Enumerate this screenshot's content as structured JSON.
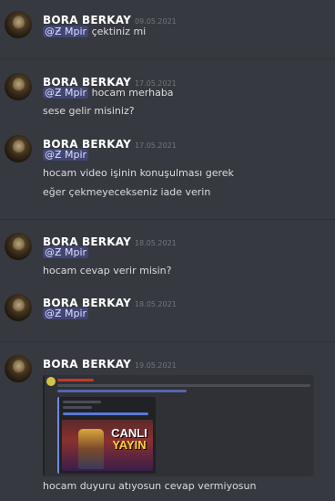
{
  "colors": {
    "background": "#36393f",
    "author": "#ffffff",
    "timestamp": "#72767d",
    "mention_bg": "#414675",
    "mention_text": "#dee0fc"
  },
  "messages": [
    {
      "author": "BORA BERKAY",
      "timestamp": "09.05.2021",
      "mention": "@Ƶ Mpir",
      "lines": [
        "çektiniz mi"
      ]
    },
    {
      "author": "BORA BERKAY",
      "timestamp": "17.05.2021",
      "mention": "@Ƶ Mpir",
      "lines": [
        "hocam merhaba",
        "sese gelir misiniz?"
      ]
    },
    {
      "author": "BORA BERKAY",
      "timestamp": "17.05.2021",
      "mention": "@Ƶ Mpir",
      "lines": [
        "hocam video işinin konuşulması gerek",
        "eğer çekmeyecekseniz iade verin"
      ]
    },
    {
      "author": "BORA BERKAY",
      "timestamp": "18.05.2021",
      "mention": "@Ƶ Mpir",
      "lines": [
        "hocam cevap verir misin?"
      ]
    },
    {
      "author": "BORA BERKAY",
      "timestamp": "18.05.2021",
      "mention": "@Ƶ Mpir",
      "lines": []
    },
    {
      "author": "BORA BERKAY",
      "timestamp": "19.05.2021",
      "attachment": {
        "thumbnail_text_1": "CANLI",
        "thumbnail_text_2": "YAYIN"
      },
      "lines": [
        "hocam duyuru atıyosun cevap vermiyosun"
      ]
    }
  ]
}
